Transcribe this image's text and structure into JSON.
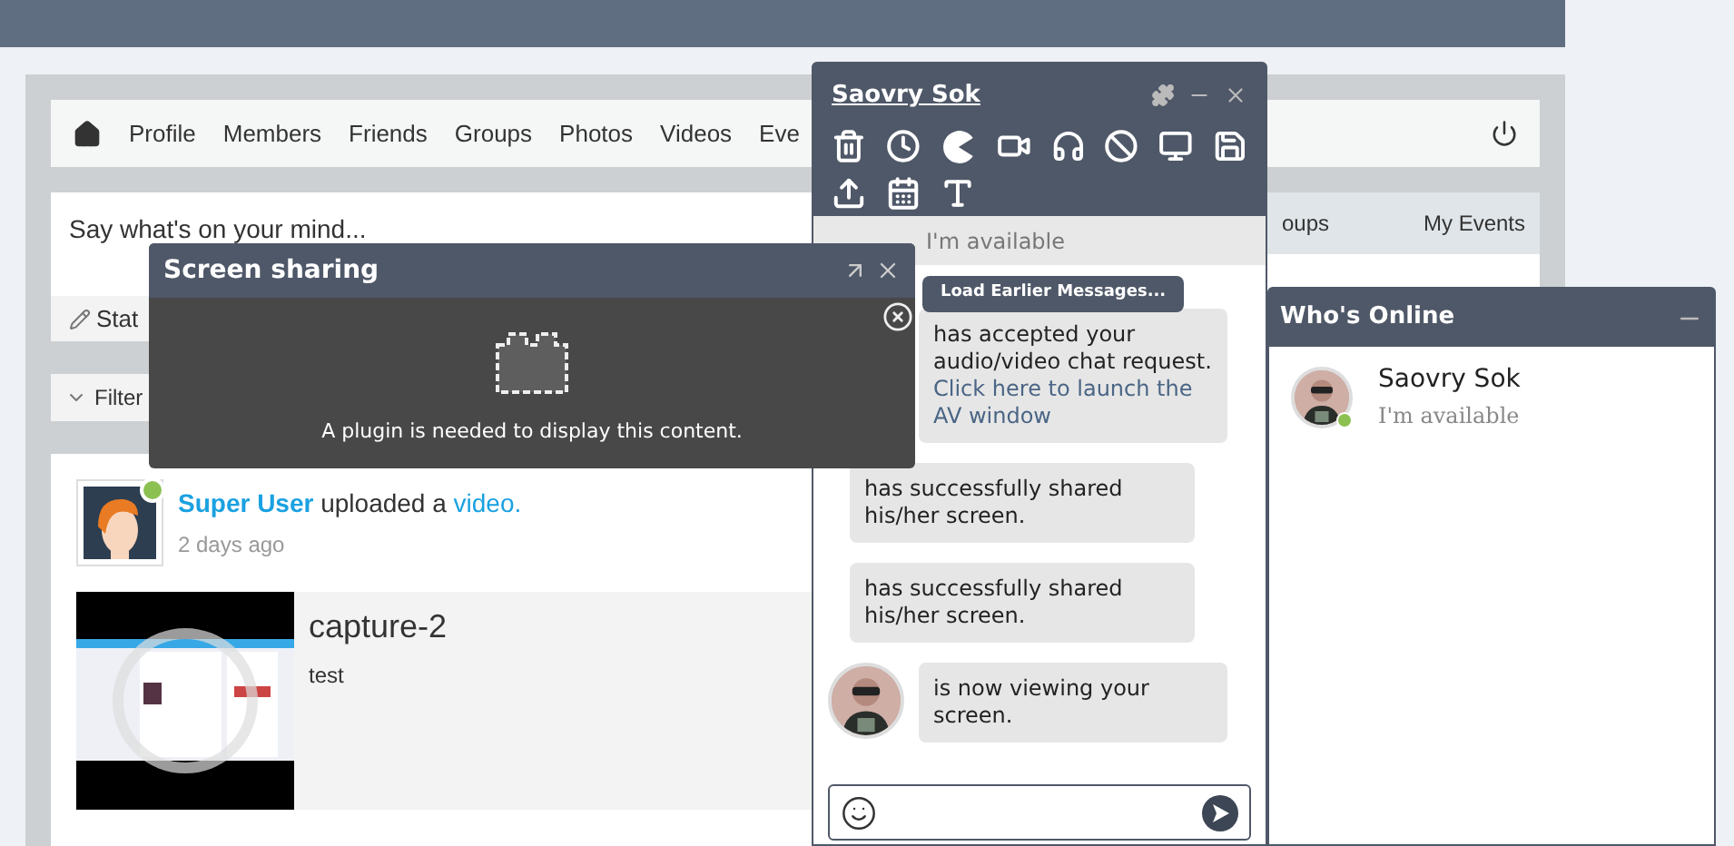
{
  "nav": {
    "items": [
      "Profile",
      "Members",
      "Friends",
      "Groups",
      "Photos",
      "Videos",
      "Eve"
    ]
  },
  "status_box": {
    "placeholder": "Say what's on your mind...",
    "tabs": [
      "oups",
      "My Events"
    ],
    "action": "Stat",
    "filter": "Filter"
  },
  "feed": {
    "author": "Super User",
    "author_online": true,
    "action": "uploaded a",
    "object": "video.",
    "time": "2 days ago",
    "video": {
      "kind": "picture",
      "title": "capture-2",
      "description": "test"
    }
  },
  "screen_sharing": {
    "title": "Screen sharing",
    "message": "A plugin is needed to display this content."
  },
  "chat": {
    "title": "Saovry Sok",
    "status": "I'm available",
    "load_button": "Load Earlier Messages...",
    "messages": [
      {
        "kind": "reply",
        "text": "has accepted your audio/video chat request.",
        "link": "Click here to launch the AV window"
      },
      {
        "kind": "notice",
        "text": "has successfully shared his/her screen."
      },
      {
        "kind": "notice",
        "text": "has successfully shared his/her screen."
      },
      {
        "kind": "reply",
        "avatar": true,
        "text": "is now viewing your screen."
      }
    ]
  },
  "whos_online": {
    "title": "Who's Online",
    "users": [
      {
        "name": "Saovry Sok",
        "status": "I'm available",
        "online": true
      }
    ]
  }
}
